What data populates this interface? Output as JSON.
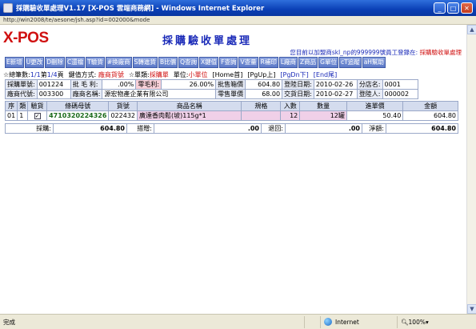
{
  "window": {
    "title": "採購驗收單處理V1.17 [X-POS 雲端商務網] - Windows Internet Explorer",
    "address": "http://win2008/te/aesone/jsh.asp?id=002000&mode"
  },
  "header": {
    "logo": "X-POS",
    "page_title": "採購驗收單處理",
    "user_prefix": "您目前以加盟商",
    "user_id": "skl_np",
    "user_mid": "的999999號員工登錄在:",
    "user_module": "採購驗收單處理"
  },
  "toolbar": [
    "E新增",
    "U更改",
    "D刪除",
    "C還檔",
    "T驗貨",
    "#換廠商",
    "S轉進貨",
    "B比價",
    "Q查詢",
    "X鍵值",
    "F查詢",
    "V查量",
    "R補印",
    "L廠商",
    "Z商品",
    "G單位",
    "cT追蹤",
    "aH幫助"
  ],
  "status": {
    "total_label": "☆總筆數:",
    "total_value": "1/1",
    "page_label": "第",
    "page_value": "1/4",
    "page_suffix": "頁",
    "key_label": "鍵值方式:",
    "key_value": "廠商貨號",
    "type_label": "☆單類:",
    "type_value": "採購單",
    "unit_label": "單位:",
    "unit_value": "小單位",
    "nav_home": "[Home首]",
    "nav_pgup": "[PgUp上]",
    "nav_pgdn": "[PgDn下]",
    "nav_end": "[End尾]"
  },
  "form": {
    "order_no_label": "採購單號:",
    "order_no": "001224",
    "gross_label": "批 毛 利:",
    "gross_value": ".00%",
    "retail_margin_label": "零毛利:",
    "retail_margin_value": "26.00%",
    "box_price_label": "批售箱價",
    "box_price": "604.80",
    "reg_date_label": "登陸日期:",
    "reg_date": "2010-02-26",
    "branch_label": "分店名:",
    "branch_value": "0001",
    "vendor_code_label": "廠商代號:",
    "vendor_code": "003300",
    "vendor_name_label": "廠商名稱:",
    "vendor_name": "源宏物產企業有限公司",
    "retail_price_label": "零售單價",
    "retail_price": "68.00",
    "delivery_date_label": "交貨日期:",
    "delivery_date": "2010-02-27",
    "registrar_label": "登陸人:",
    "registrar_value": "000002"
  },
  "grid": {
    "columns": [
      "序",
      "類",
      "驗貨",
      "條碼母號",
      "貨號",
      "商品名稱",
      "規格",
      "入數",
      "數量",
      "進單價",
      "金額"
    ],
    "rows": [
      {
        "seq": "01",
        "type": "1",
        "checked": "✓",
        "barcode": "4710320224326",
        "item_no": "022432",
        "name": "廣達香肉鬆(坡)115g*1",
        "spec": "",
        "pack": "12",
        "qty": "12罐",
        "unit_price": "50.40",
        "amount": "604.80"
      }
    ]
  },
  "totals": {
    "purchase_label": "採購:",
    "purchase_value": "604.80",
    "discount_label": "搭贈:",
    "discount_value": ".00",
    "return_label": "退回:",
    "return_value": ".00",
    "net_label": "淨額:",
    "net_value": "604.80"
  },
  "statusbar": {
    "done": "完成",
    "zone": "Internet",
    "zoom": "100%"
  }
}
